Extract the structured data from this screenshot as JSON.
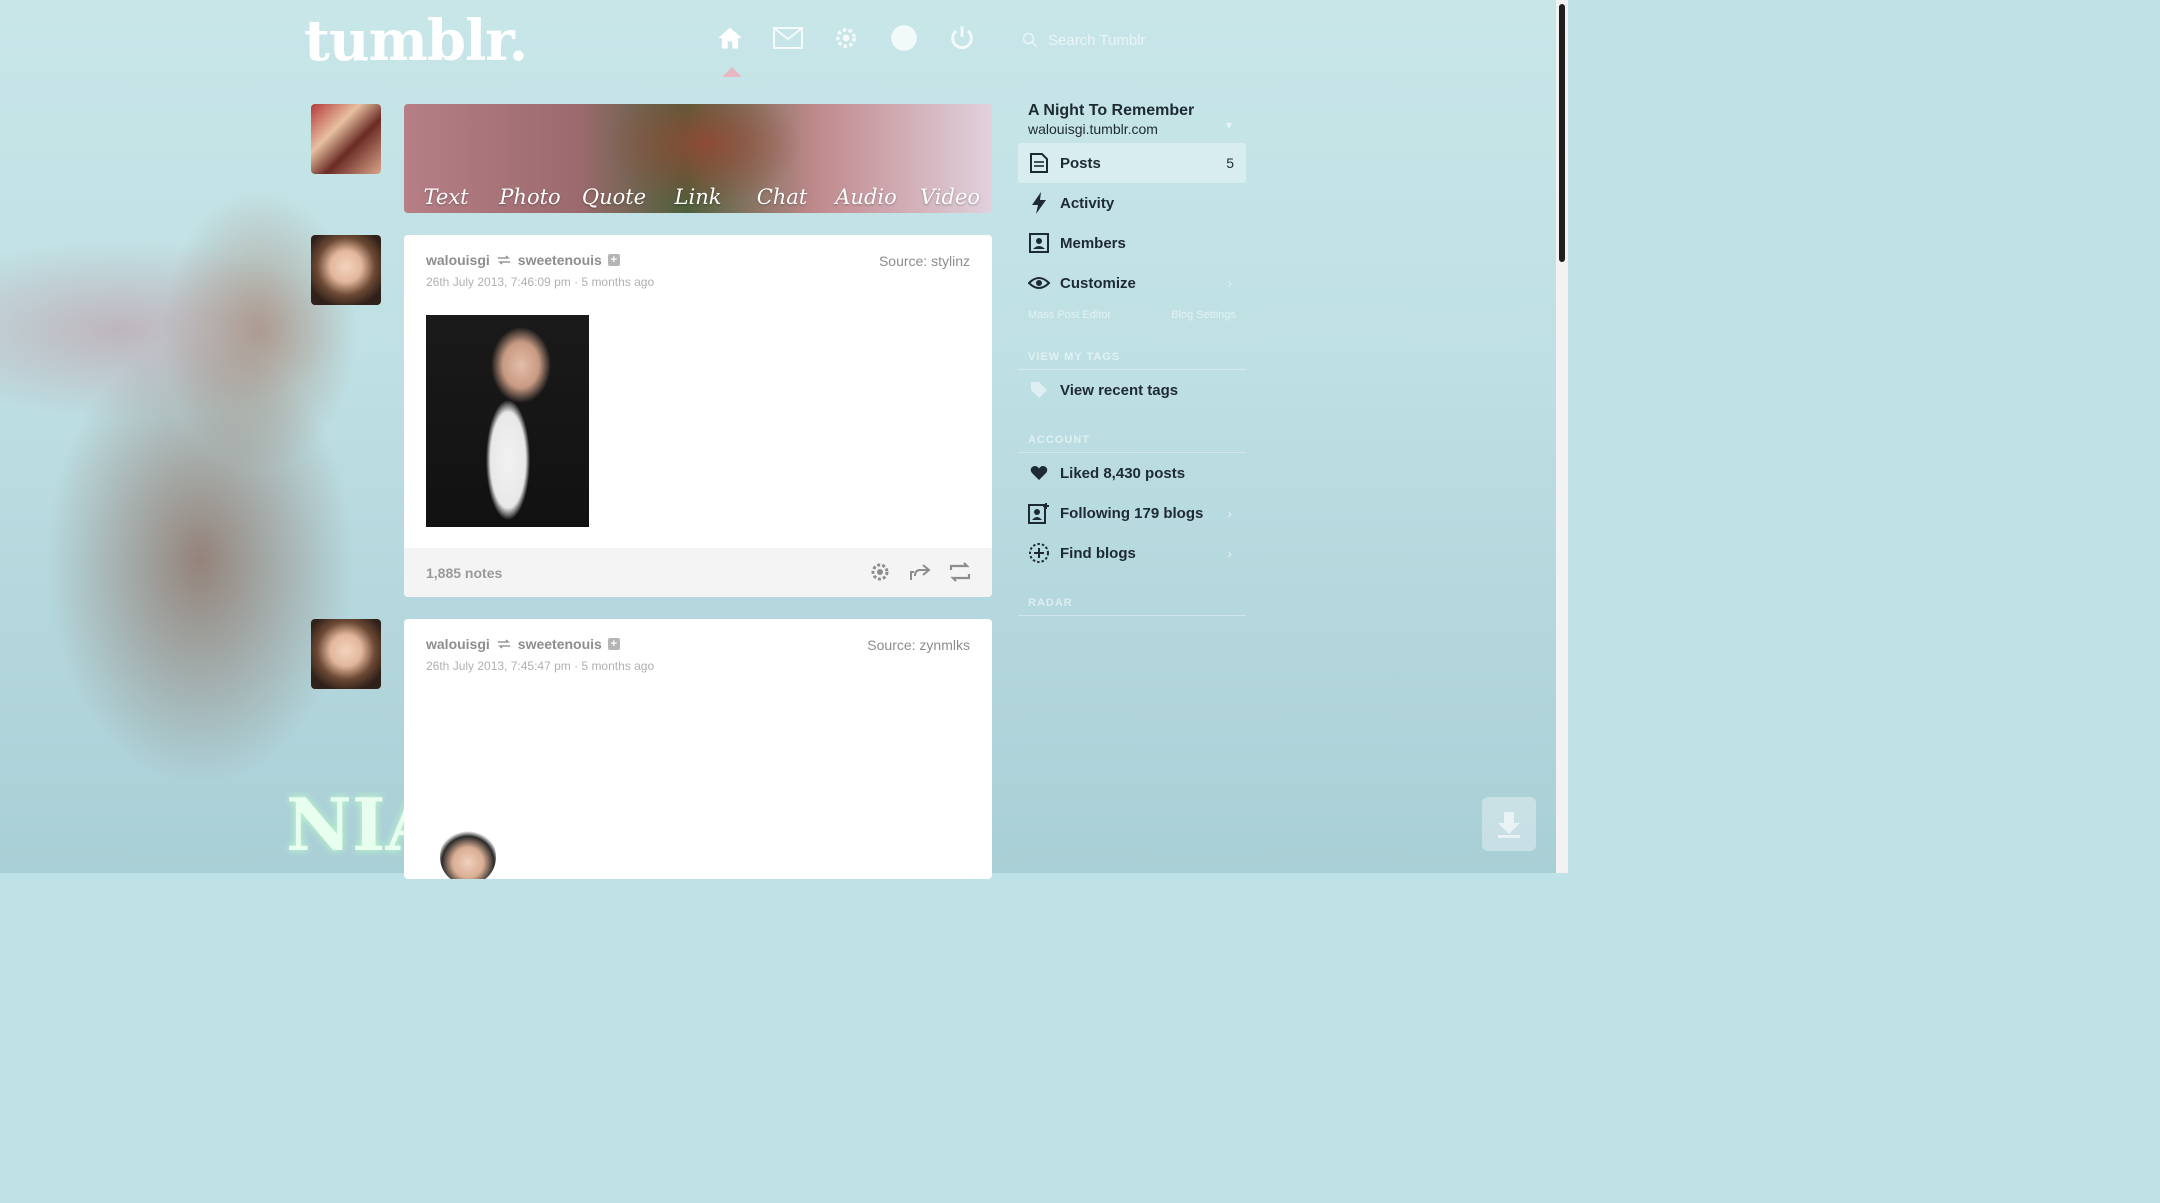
{
  "app": {
    "logo": "tumblr."
  },
  "search": {
    "placeholder": "Search Tumblr"
  },
  "composer": {
    "types": [
      "Text",
      "Photo",
      "Quote",
      "Link",
      "Chat",
      "Audio",
      "Video"
    ]
  },
  "posts": [
    {
      "author": "walouisgi",
      "reblogged_from": "sweetenouis",
      "date": "26th July 2013, 7:46:09 pm · 5 months ago",
      "source": "Source: stylinz",
      "notes": "1,885 notes"
    },
    {
      "author": "walouisgi",
      "reblogged_from": "sweetenouis",
      "date": "26th July 2013, 7:45:47 pm · 5 months ago",
      "source": "Source: zynmlks"
    }
  ],
  "sidebar": {
    "blog_title": "A Night To Remember",
    "blog_url": "walouisgi.tumblr.com",
    "items": [
      {
        "label": "Posts",
        "count": "5",
        "icon": "posts-icon"
      },
      {
        "label": "Activity",
        "icon": "bolt-icon"
      },
      {
        "label": "Members",
        "icon": "members-icon"
      },
      {
        "label": "Customize",
        "icon": "eye-icon"
      }
    ],
    "sub_links": [
      "Mass Post Editor",
      "Blog Settings"
    ],
    "tags_label": "VIEW MY TAGS",
    "tags_item": "View recent tags",
    "account_label": "ACCOUNT",
    "account_items": [
      {
        "label": "Liked 8,430 posts",
        "icon": "heart-icon"
      },
      {
        "label": "Following 179 blogs",
        "icon": "following-icon"
      },
      {
        "label": "Find blogs",
        "icon": "find-icon"
      }
    ],
    "radar_label": "RADAR"
  },
  "background": {
    "text": "NIA"
  },
  "colors": {
    "accent": "#bfe2e6",
    "text_dark": "#1e2a33",
    "nav_caret": "#e7b8c4"
  }
}
